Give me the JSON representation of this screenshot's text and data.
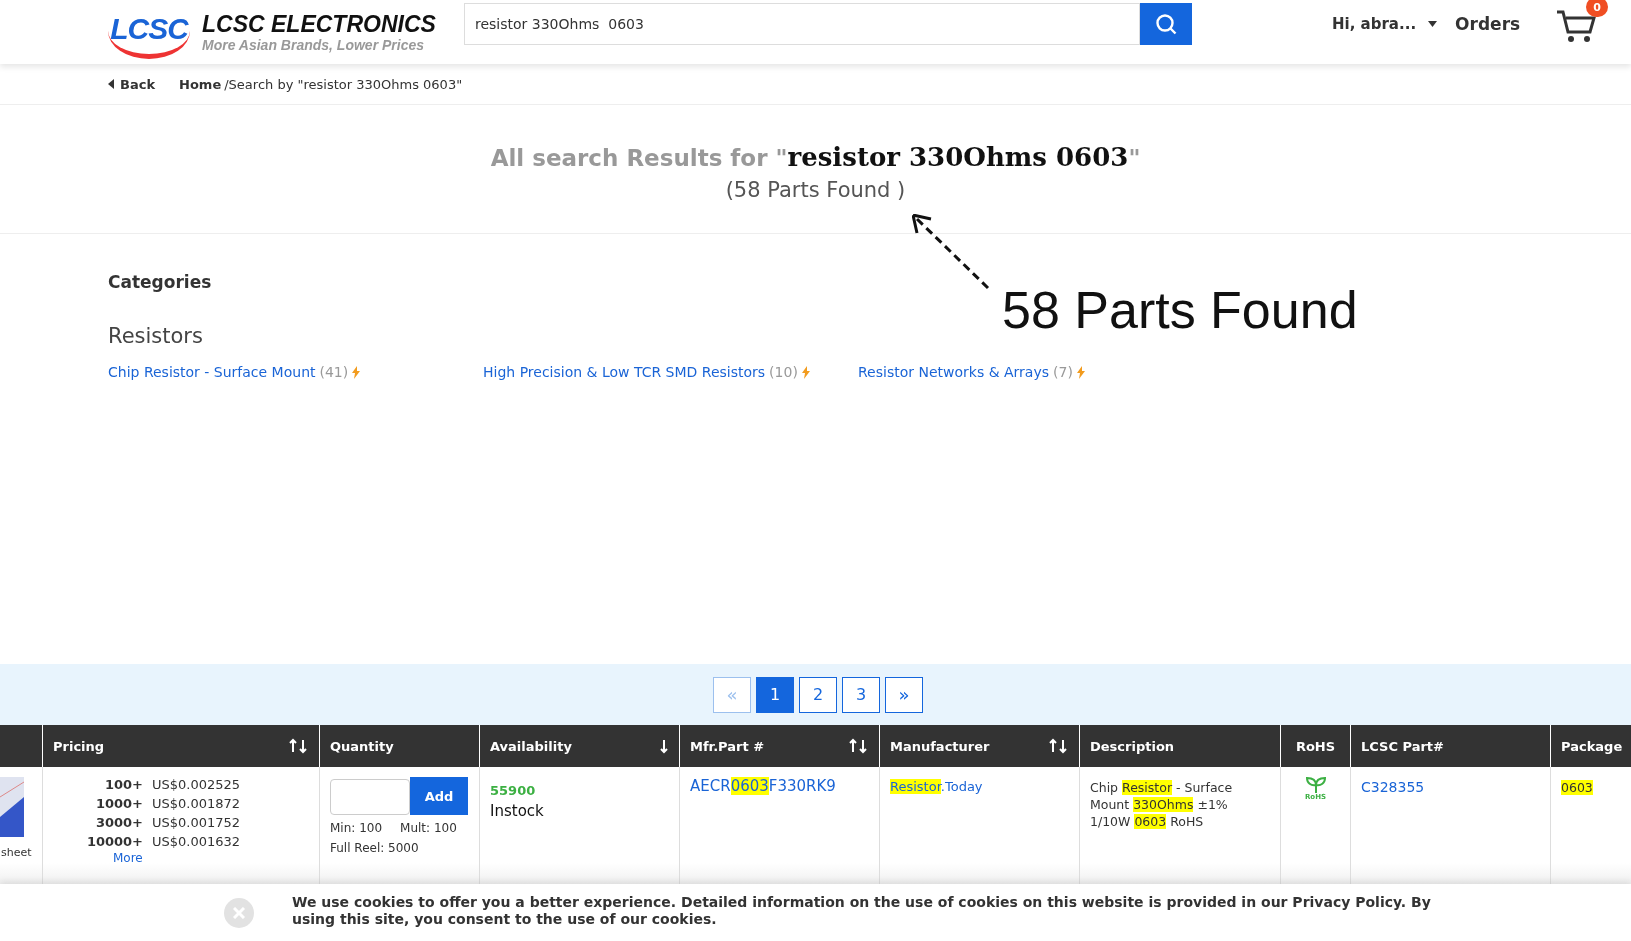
{
  "header": {
    "brand": "LCSC ELECTRONICS",
    "tagline": "More Asian Brands, Lower Prices",
    "logo_text": "LCSC",
    "search": {
      "value": "resistor 330Ohms  0603"
    },
    "user": "Hi, abra...",
    "orders": "Orders",
    "cart_count": "0"
  },
  "breadcrumb": {
    "back": "Back",
    "home": "Home",
    "trail": "/Search by \"resistor 330Ohms 0603\""
  },
  "results": {
    "prefix": "All search Results for \"",
    "query": "resistor 330Ohms 0603",
    "suffix": "\"",
    "count": "(58 Parts Found )"
  },
  "annotation": {
    "text": "58 Parts Found"
  },
  "categories": {
    "title": "Categories",
    "group": "Resistors",
    "items": [
      {
        "label": "Chip Resistor - Surface Mount",
        "count": "(41)"
      },
      {
        "label": "High Precision & Low TCR SMD Resistors",
        "count": "(10)"
      },
      {
        "label": "Resistor Networks & Arrays",
        "count": "(7)"
      }
    ]
  },
  "pagination": [
    {
      "label": "«",
      "kind": "prev",
      "selected": false,
      "disabled": true
    },
    {
      "label": "1",
      "kind": "page",
      "selected": true,
      "disabled": false
    },
    {
      "label": "2",
      "kind": "page",
      "selected": false,
      "disabled": false
    },
    {
      "label": "3",
      "kind": "page",
      "selected": false,
      "disabled": false
    },
    {
      "label": "»",
      "kind": "next",
      "selected": false,
      "disabled": false
    }
  ],
  "table": {
    "columns": [
      {
        "kind": "blank"
      },
      {
        "label": "Pricing",
        "kind": "sort-both"
      },
      {
        "label": "Quantity",
        "kind": "plain"
      },
      {
        "label": "Availability",
        "kind": "sort-down"
      },
      {
        "label": "Mfr.Part #",
        "kind": "sort-both"
      },
      {
        "label": "Manufacturer",
        "kind": "sort-both"
      },
      {
        "label": "Description",
        "kind": "plain"
      },
      {
        "label": "RoHS",
        "kind": "plain"
      },
      {
        "label": "LCSC Part#",
        "kind": "plain"
      },
      {
        "label": "Package",
        "kind": "plain"
      }
    ],
    "row": {
      "datasheet": "sheet",
      "prices": [
        {
          "qty": "100+",
          "price": "US$0.002525"
        },
        {
          "qty": "1000+",
          "price": "US$0.001872"
        },
        {
          "qty": "3000+",
          "price": "US$0.001752"
        },
        {
          "qty": "10000+",
          "price": "US$0.001632"
        }
      ],
      "more": "More",
      "add": "Add",
      "min": "Min: 100",
      "mult": "Mult: 100",
      "reel": "Full Reel: 5000",
      "stock": "55900",
      "stock_status": "Instock",
      "mfr_part": [
        {
          "text": "AECR",
          "highlight": false
        },
        {
          "text": "0603",
          "highlight": true
        },
        {
          "text": "F330RK9",
          "highlight": false
        }
      ],
      "manufacturer": [
        {
          "text": "Resistor",
          "highlight": true
        },
        {
          "text": ".Today",
          "highlight": false
        }
      ],
      "description": [
        {
          "text": "Chip ",
          "highlight": false
        },
        {
          "text": "Resistor",
          "highlight": true
        },
        {
          "text": " - Surface Mount ",
          "highlight": false
        },
        {
          "text": "330Ohms",
          "highlight": true
        },
        {
          "text": " ±1% 1/10W ",
          "highlight": false
        },
        {
          "text": "0603",
          "highlight": true
        },
        {
          "text": " RoHS",
          "highlight": false
        }
      ],
      "rohs_label": "RoHS",
      "lcsc_part": "C328355",
      "package": [
        {
          "text": "0603",
          "highlight": true
        }
      ]
    }
  },
  "cookie": {
    "text": "We use cookies to offer you a better experience. Detailed information on the use of cookies on this website is provided in our Privacy Policy. By using this site, you consent to the use of our cookies."
  }
}
